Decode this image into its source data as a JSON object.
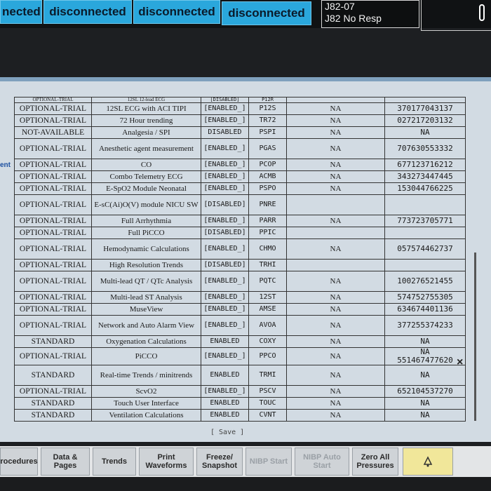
{
  "topbar": {
    "buttons": [
      "nected",
      "disconnected",
      "disconnected",
      "disconnected"
    ],
    "jbox_line1": "J82-07",
    "jbox_line2": "J82 No Resp"
  },
  "side_labels": [
    "ent"
  ],
  "table": {
    "partial_row": {
      "status": "OPTIONAL-TRIAL",
      "feature": "12SL 12-lead ECG",
      "state": "[DISABLED]",
      "code": "P12R"
    },
    "rows": [
      {
        "status": "OPTIONAL-TRIAL",
        "feature": "12SL ECG with ACI TIPI",
        "state": "[ENABLED_]",
        "code": "P12S",
        "na": "NA",
        "lic": "370177043137"
      },
      {
        "status": "OPTIONAL-TRIAL",
        "feature": "72 Hour trending",
        "state": "[ENABLED_]",
        "code": "TR72",
        "na": "NA",
        "lic": "027217203132"
      },
      {
        "status": "NOT-AVAILABLE",
        "feature": "Analgesia / SPI",
        "state": "DISABLED",
        "code": "PSPI",
        "na": "NA",
        "lic": "NA"
      },
      {
        "status": "OPTIONAL-TRIAL",
        "feature": "Anesthetic agent measurement",
        "state": "[ENABLED_]",
        "code": "PGAS",
        "na": "NA",
        "lic": "707630553332",
        "tall": true
      },
      {
        "status": "OPTIONAL-TRIAL",
        "feature": "CO",
        "state": "[ENABLED_]",
        "code": "PCOP",
        "na": "NA",
        "lic": "677123716212"
      },
      {
        "status": "OPTIONAL-TRIAL",
        "feature": "Combo Telemetry ECG",
        "state": "[ENABLED_]",
        "code": "ACMB",
        "na": "NA",
        "lic": "343273447445"
      },
      {
        "status": "OPTIONAL-TRIAL",
        "feature": "E-SpO2 Module Neonatal",
        "state": "[ENABLED_]",
        "code": "PSPO",
        "na": "NA",
        "lic": "153044766225"
      },
      {
        "status": "OPTIONAL-TRIAL",
        "feature": "E-sC(Ai)O(V) module NICU SW",
        "state": "[DISABLED]",
        "code": "PNRE",
        "na": "",
        "lic": "",
        "tall": true
      },
      {
        "status": "OPTIONAL-TRIAL",
        "feature": "Full Arrhythmia",
        "state": "[ENABLED_]",
        "code": "PARR",
        "na": "NA",
        "lic": "773723705771"
      },
      {
        "status": "OPTIONAL-TRIAL",
        "feature": "Full PiCCO",
        "state": "[DISABLED]",
        "code": "PPIC",
        "na": "",
        "lic": ""
      },
      {
        "status": "OPTIONAL-TRIAL",
        "feature": "Hemodynamic Calculations",
        "state": "[ENABLED_]",
        "code": "CHMO",
        "na": "NA",
        "lic": "057574462737",
        "tall": true
      },
      {
        "status": "OPTIONAL-TRIAL",
        "feature": "High Resolution Trends",
        "state": "[DISABLED]",
        "code": "TRHI",
        "na": "",
        "lic": ""
      },
      {
        "status": "OPTIONAL-TRIAL",
        "feature": "Multi-lead QT / QTc Analysis",
        "state": "[ENABLED_]",
        "code": "PQTC",
        "na": "NA",
        "lic": "100276521455",
        "tall": true
      },
      {
        "status": "OPTIONAL-TRIAL",
        "feature": "Multi-lead ST Analysis",
        "state": "[ENABLED_]",
        "code": "12ST",
        "na": "NA",
        "lic": "574752755305"
      },
      {
        "status": "OPTIONAL-TRIAL",
        "feature": "MuseView",
        "state": "[ENABLED_]",
        "code": "AMSE",
        "na": "NA",
        "lic": "634674401136"
      },
      {
        "status": "OPTIONAL-TRIAL",
        "feature": "Network and Auto Alarm View",
        "state": "[ENABLED_]",
        "code": "AVOA",
        "na": "NA",
        "lic": "377255374233",
        "tall": true
      },
      {
        "status": "STANDARD",
        "feature": "Oxygenation Calculations",
        "state": "ENABLED",
        "code": "COXY",
        "na": "NA",
        "lic": "NA"
      },
      {
        "status": "OPTIONAL-TRIAL",
        "feature": "PiCCO",
        "state": "[ENABLED_]",
        "code": "PPCO",
        "na": "NA",
        "lic": "NA"
      },
      {
        "status": "STANDARD",
        "feature": "Real-time Trends / minitrends",
        "state": "ENABLED",
        "code": "TRMI",
        "na": "NA",
        "lic": "NA",
        "tall": true
      },
      {
        "status": "OPTIONAL-TRIAL",
        "feature": "ScvO2",
        "state": "[ENABLED_]",
        "code": "PSCV",
        "na": "NA",
        "lic": "652104537270"
      },
      {
        "status": "STANDARD",
        "feature": "Touch User Interface",
        "state": "ENABLED",
        "code": "TOUC",
        "na": "NA",
        "lic": "NA"
      },
      {
        "status": "STANDARD",
        "feature": "Ventilation Calculations",
        "state": "ENABLED",
        "code": "CVNT",
        "na": "NA",
        "lic": "NA"
      }
    ],
    "extra_license_ppco": "551467477620"
  },
  "save_label": "[ Save ]",
  "close_symbol": "×",
  "bottom_nav": [
    {
      "label": "rocedures",
      "dim": false
    },
    {
      "label": "Data & Pages",
      "dim": false
    },
    {
      "label": "Trends",
      "dim": false
    },
    {
      "label": "Print Waveforms",
      "dim": false
    },
    {
      "label": "Freeze/ Snapshot",
      "dim": false
    },
    {
      "label": "NIBP Start",
      "dim": true
    },
    {
      "label": "NIBP Auto Start",
      "dim": true
    },
    {
      "label": "Zero All Pressures",
      "dim": false
    }
  ],
  "alarm_icon": "bell-icon",
  "colors": {
    "connection_button": "#2aa7dc",
    "screen_bg": "#d2dbe3",
    "alarm_button": "#f1e79a"
  }
}
